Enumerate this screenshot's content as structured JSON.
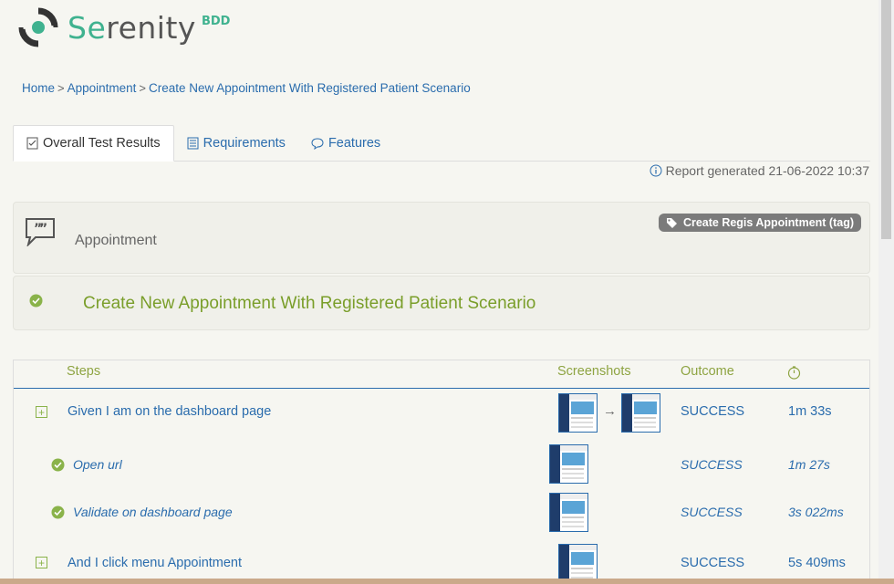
{
  "logo": {
    "text_se": "Se",
    "text_rest": "renity",
    "suffix": "BDD"
  },
  "breadcrumb": [
    {
      "label": "Home"
    },
    {
      "label": "Appointment"
    },
    {
      "label": "Create New Appointment With Registered Patient Scenario"
    }
  ],
  "breadcrumb_sep": ">",
  "tabs": [
    {
      "label": "Overall Test Results",
      "active": true,
      "icon": "checklist-icon"
    },
    {
      "label": "Requirements",
      "active": false,
      "icon": "list-icon"
    },
    {
      "label": "Features",
      "active": false,
      "icon": "comment-icon"
    }
  ],
  "report": {
    "text": "Report generated 21-06-2022 10:37"
  },
  "feature": {
    "title": "Appointment",
    "tag": "Create Regis Appointment (tag)"
  },
  "scenario": {
    "title": "Create New Appointment With Registered Patient Scenario",
    "status_color": "#8ab34a"
  },
  "table": {
    "headers": {
      "steps": "Steps",
      "screenshots": "Screenshots",
      "outcome": "Outcome",
      "duration_icon": "stopwatch-icon"
    },
    "rows": [
      {
        "step": "Given I am on the dashboard page",
        "outcome": "SUCCESS",
        "duration": "1m 33s",
        "level": "main",
        "arrow": "→"
      },
      {
        "step": "Open url",
        "outcome": "SUCCESS",
        "duration": "1m 27s",
        "level": "sub"
      },
      {
        "step": "Validate on dashboard page",
        "outcome": "SUCCESS",
        "duration": "3s 022ms",
        "level": "sub"
      },
      {
        "step": "And I click menu Appointment",
        "outcome": "SUCCESS",
        "duration": "5s 409ms",
        "level": "main"
      }
    ]
  },
  "colors": {
    "brand": "#3fb28f",
    "link": "#2a6cad",
    "success": "#8ab34a",
    "header": "#8ea442"
  }
}
